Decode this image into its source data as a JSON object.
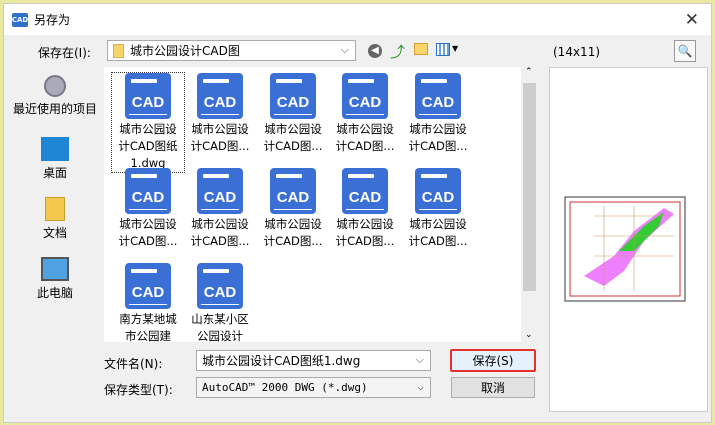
{
  "window": {
    "title": "另存为",
    "app_icon": "CAD"
  },
  "toolbar": {
    "save_in_label": "保存在(I):",
    "location": "城市公园设计CAD图",
    "preview_size": "(14x11)"
  },
  "sidebar": {
    "items": [
      {
        "label": "最近使用的项目",
        "icon": "recent-icon"
      },
      {
        "label": "桌面",
        "icon": "desktop-icon"
      },
      {
        "label": "文档",
        "icon": "documents-icon"
      },
      {
        "label": "此电脑",
        "icon": "computer-icon"
      }
    ]
  },
  "files": [
    {
      "line1": "城市公园设",
      "line2": "计CAD图纸",
      "line3": "1.dwg",
      "icon_text": "CAD"
    },
    {
      "line1": "城市公园设",
      "line2": "计CAD图...",
      "icon_text": "CAD"
    },
    {
      "line1": "城市公园设",
      "line2": "计CAD图...",
      "icon_text": "CAD"
    },
    {
      "line1": "城市公园设",
      "line2": "计CAD图...",
      "icon_text": "CAD"
    },
    {
      "line1": "城市公园设",
      "line2": "计CAD图...",
      "icon_text": "CAD"
    },
    {
      "line1": "城市公园设",
      "line2": "计CAD图...",
      "icon_text": "CAD"
    },
    {
      "line1": "城市公园设",
      "line2": "计CAD图...",
      "icon_text": "CAD"
    },
    {
      "line1": "城市公园设",
      "line2": "计CAD图...",
      "icon_text": "CAD"
    },
    {
      "line1": "城市公园设",
      "line2": "计CAD图...",
      "icon_text": "CAD"
    },
    {
      "line1": "城市公园设",
      "line2": "计CAD图...",
      "icon_text": "CAD"
    },
    {
      "line1": "南方某地城",
      "line2": "市公园建",
      "icon_text": "CAD"
    },
    {
      "line1": "山东某小区",
      "line2": "公园设计",
      "icon_text": "CAD"
    }
  ],
  "form": {
    "filename_label": "文件名(N):",
    "filename_value": "城市公园设计CAD图纸1.dwg",
    "filetype_label": "保存类型(T):",
    "filetype_value": "AutoCAD™ 2000 DWG (*.dwg)",
    "save_label": "保存(S)",
    "cancel_label": "取消"
  },
  "colors": {
    "accent": "#3a6fd6",
    "highlight": "#e53030"
  }
}
